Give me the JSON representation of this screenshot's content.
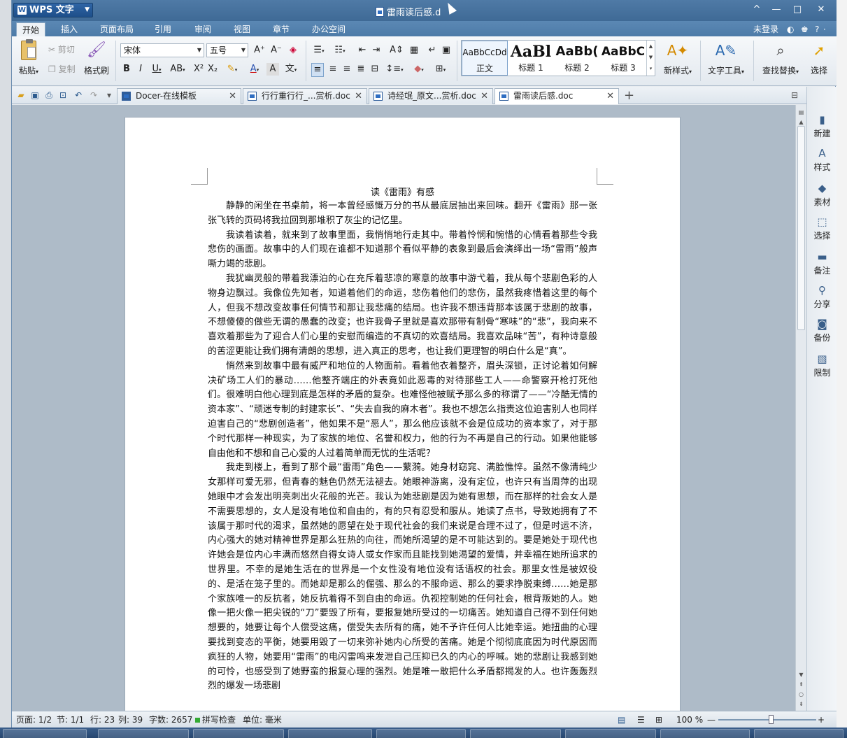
{
  "window": {
    "app_name": "WPS 文字",
    "title": "雷雨读后感.d",
    "controls": [
      "^",
      "—",
      "□",
      "✕"
    ]
  },
  "ribbon_tabs": [
    "开始",
    "插入",
    "页面布局",
    "引用",
    "审阅",
    "视图",
    "章节",
    "办公空间"
  ],
  "ribbon_right": {
    "login": "未登录",
    "help": "?"
  },
  "clipboard": {
    "paste": "粘贴",
    "cut": "剪切",
    "copy": "复制",
    "format_painter": "格式刷"
  },
  "font": {
    "name": "宋体",
    "size": "五号"
  },
  "styles": [
    {
      "sample": "AaBbCcDd",
      "label": "正文"
    },
    {
      "sample": "AaBl",
      "label": "标题 1"
    },
    {
      "sample": "AaBb(",
      "label": "标题 2"
    },
    {
      "sample": "AaBbC",
      "label": "标题 3"
    }
  ],
  "ribbon_buttons": {
    "new_style": "新样式",
    "text_tools": "文字工具",
    "find_replace": "查找替换",
    "select": "选择"
  },
  "doc_tabs": [
    {
      "label": "Docer-在线模板"
    },
    {
      "label": "行行重行行_...赏析.doc"
    },
    {
      "label": "诗经氓_原文...赏析.doc"
    },
    {
      "label": "雷雨读后感.doc"
    }
  ],
  "taskpane": [
    "新建",
    "样式",
    "素材",
    "选择",
    "备注",
    "分享",
    "备份",
    "限制"
  ],
  "document": {
    "title": "读《雷雨》有感",
    "paragraphs": [
      "静静的闲坐在书桌前，将一本曾经感慨万分的书从最底层抽出来回味。翻开《雷雨》那一张张飞转的页码将我拉回到那堆积了灰尘的记忆里。",
      "我读着读着，就来到了故事里面，我悄悄地行走其中。带着怜悯和惋惜的心情看着那些令我悲伤的画面。故事中的人们现在谁都不知道那个看似平静的表象到最后会演绎出一场“雷雨”般声嘶力竭的悲剧。",
      "我犹幽灵般的带着我漂泊的心在充斥着悲凉的寒意的故事中游弋着，我从每个悲剧色彩的人物身边飘过。我像位先知者，知道着他们的命运，悲伤着他们的悲伤，虽然我疼惜着这里的每个人，但我不想改变故事任何情节和那让我悲痛的结局。也许我不想违背那本该属于悲剧的故事，不想傻傻的做些无谓的愚蠢的改变；也许我骨子里就是喜欢那带有制骨“寒味”的“悲”，我向来不喜欢着那些为了迎合人们心里的安慰而编造的不真切的欢喜结局。我喜欢品味“苦”，有种诗意般的苦涩更能让我们拥有清朗的思想，进入真正的思考，也让我们更理智的明白什么是“真”。",
      "悄然来到故事中最有威严和地位的人物面前。看着他衣着整齐，眉头深锁，正讨论着如何解决矿场工人们的暴动……他整齐端庄的外表竟如此恶毒的对待那些工人——命警察开枪打死他们。很难明白他心理到底是怎样的矛盾的复杂。也难怪他被赋予那么多的称谓了——“冷酷无情的资本家”、“顽迷专制的封建家长”、“失去自我的麻木者”。我也不想怎么指责这位迫害别人也同样迫害自己的“悲剧创造者”，他如果不是“恶人”，那么他应该就不会是位成功的资本家了，对于那个时代那样一种现实，为了家族的地位、名誉和权力，他的行为不再是自己的行动。如果他能够自由他和不想和自己心爱的人过着简单而无忧的生活呢？",
      "我走到楼上，看到了那个最“雷雨”角色——蘩漪。她身材窈窕、满脸憔悴。虽然不像清纯少女那样可爱无邪，但青春的魅色仍然无法褪去。她眼神游离，没有定位，也许只有当周萍的出现她眼中才会发出明亮刺出火花般的光芒。我认为她悲剧是因为她有思想，而在那样的社会女人是不需要思想的，女人是没有地位和自由的，有的只有忍受和服从。她读了点书，导致她拥有了不该属于那时代的渴求，虽然她的愿望在处于现代社会的我们来说是合理不过了，但是时运不济，内心强大的她对精神世界是那么狂热的向往，而她所渴望的是不可能达到的。要是她处于现代也许她会是位内心丰满而悠然自得女诗人或女作家而且能找到她渴望的爱情，并幸福在她所追求的世界里。不幸的是她生活在的世界是一个女性没有地位没有话语权的社会。那里女性是被奴役的、是活在笼子里的。而她却是那么的倔强、那么的不服命运、那么的要求挣脱束缚……她是那个家族唯一的反抗者，她反抗着得不到自由的命运。仇视控制她的任何社会，根背叛她的人。她像一把火像一把尖锐的“刀”要毁了所有，要报复她所受过的一切痛苦。她知道自己得不到任何她想要的，她要让每个人偿受这痛，偿受失去所有的痛，她不予许任何人比她幸运。她扭曲的心理要找到变态的平衡，她要用毁了一切来弥补她内心所受的苦痛。她是个彻彻底底因为时代原因而疯狂的人物，她要用“雷雨”的电闪雷鸣来发泄自己压抑已久的内心的呼喊。她的悲剧让我感到她的可怜，也感受到了她野蛮的报复心理的强烈。她是唯一敢把什么矛盾都揭发的人。也许轰轰烈烈的爆发一场悲剧"
    ]
  },
  "status": {
    "page": "页面: 1/2",
    "section": "节: 1/1",
    "row": "行: 23",
    "col": "列: 39",
    "words": "字数: 2657",
    "spell": "拼写检查",
    "unit": "单位: 毫米",
    "zoom": "100 %",
    "zoom_level": 1.0
  }
}
